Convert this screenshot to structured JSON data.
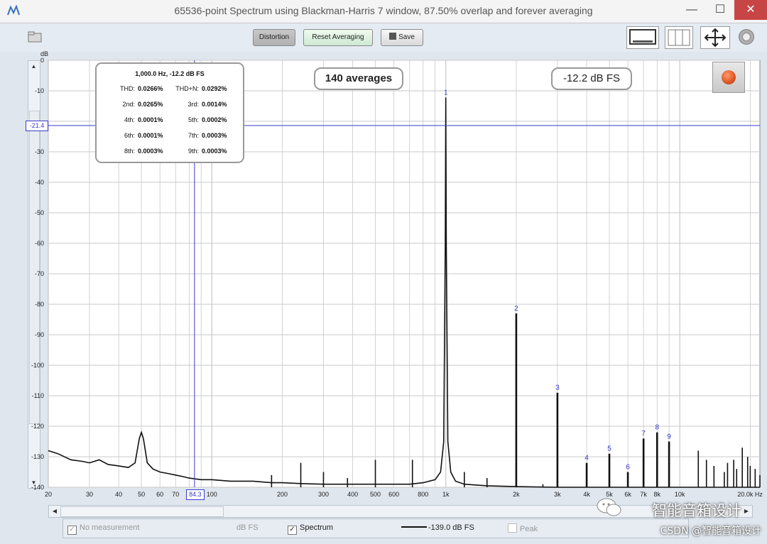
{
  "window": {
    "title": "65536-point Spectrum using Blackman-Harris 7 window, 87.50% overlap and forever averaging",
    "minimize": "—",
    "maximize": "☐",
    "close": "✕"
  },
  "toolbar": {
    "distortion_label": "Distortion",
    "reset_label": "Reset Averaging",
    "save_label": "Save"
  },
  "overlay": {
    "averages": "140 averages",
    "level": "-12.2 dB FS",
    "cursor_y": "-21.4",
    "cursor_x": "84.3"
  },
  "distortion_box": {
    "header": "1,000.0 Hz, -12.2 dB FS",
    "rows": [
      [
        {
          "k": "THD:",
          "v": "0.0266%"
        },
        {
          "k": "THD+N:",
          "v": "0.0292%"
        }
      ],
      [
        {
          "k": "2nd:",
          "v": "0.0265%"
        },
        {
          "k": "3rd:",
          "v": "0.0014%"
        }
      ],
      [
        {
          "k": "4th:",
          "v": "0.0001%"
        },
        {
          "k": "5th:",
          "v": "0.0002%"
        }
      ],
      [
        {
          "k": "6th:",
          "v": "0.0001%"
        },
        {
          "k": "7th:",
          "v": "0.0003%"
        }
      ],
      [
        {
          "k": "8th:",
          "v": "0.0003%"
        },
        {
          "k": "9th:",
          "v": "0.0003%"
        }
      ]
    ]
  },
  "colors": {
    "trace": "#111111",
    "grid": "#c8c8c8",
    "cursor": "#3a3acc",
    "marker_label": "#3a3acc",
    "record_button": "#e05a2a"
  },
  "bottom": {
    "no_measurement": "No measurement",
    "dbfs_label": "dB FS",
    "spectrum_label": "Spectrum",
    "spectrum_value": "-139.0 dB FS",
    "peak_label": "Peak"
  },
  "watermark": {
    "line1": "智能音箱设计",
    "line2": "CSDN @智能音箱设计"
  },
  "chart_data": {
    "type": "line",
    "title": "",
    "ylabel": "dB",
    "xlabel": "",
    "x_scale": "log",
    "xlim": [
      20,
      22000
    ],
    "ylim": [
      -140,
      0
    ],
    "grid": true,
    "y_ticks": [
      0,
      -10,
      -20,
      -30,
      -40,
      -50,
      -60,
      -70,
      -80,
      -90,
      -100,
      -110,
      -120,
      -130,
      -140
    ],
    "y_tick_labels": [
      "0",
      "-10",
      "",
      "-30",
      "-40",
      "-50",
      "-60",
      "-70",
      "-80",
      "-90",
      "-100",
      "-110",
      "-120",
      "-130",
      "-140"
    ],
    "x_ticks": [
      {
        "v": 20,
        "label": "20"
      },
      {
        "v": 30,
        "label": "30"
      },
      {
        "v": 40,
        "label": "40"
      },
      {
        "v": 50,
        "label": "50"
      },
      {
        "v": 60,
        "label": "60"
      },
      {
        "v": 70,
        "label": "70"
      },
      {
        "v": 100,
        "label": "100"
      },
      {
        "v": 200,
        "label": "200"
      },
      {
        "v": 300,
        "label": "300"
      },
      {
        "v": 400,
        "label": "400"
      },
      {
        "v": 500,
        "label": "500"
      },
      {
        "v": 600,
        "label": "600"
      },
      {
        "v": 800,
        "label": "800"
      },
      {
        "v": 1000,
        "label": "1k"
      },
      {
        "v": 2000,
        "label": "2k"
      },
      {
        "v": 3000,
        "label": "3k"
      },
      {
        "v": 4000,
        "label": "4k"
      },
      {
        "v": 5000,
        "label": "5k"
      },
      {
        "v": 6000,
        "label": "6k"
      },
      {
        "v": 7000,
        "label": "7k"
      },
      {
        "v": 8000,
        "label": "8k"
      },
      {
        "v": 10000,
        "label": "10k"
      },
      {
        "v": 20000,
        "label": "20.0k Hz"
      }
    ],
    "cursor": {
      "x": 84.3,
      "y": -21.4
    },
    "series": [
      {
        "values": [
          [
            20,
            -128
          ],
          [
            22,
            -129
          ],
          [
            25,
            -131
          ],
          [
            28,
            -131.5
          ],
          [
            30,
            -132
          ],
          [
            33,
            -131
          ],
          [
            36,
            -132.5
          ],
          [
            40,
            -133
          ],
          [
            44,
            -133.5
          ],
          [
            47,
            -132
          ],
          [
            49,
            -124
          ],
          [
            50,
            -122
          ],
          [
            51,
            -124
          ],
          [
            53,
            -132
          ],
          [
            56,
            -134
          ],
          [
            60,
            -135
          ],
          [
            65,
            -135.5
          ],
          [
            70,
            -136
          ],
          [
            75,
            -136.5
          ],
          [
            80,
            -137
          ],
          [
            90,
            -137.5
          ],
          [
            100,
            -137.5
          ],
          [
            120,
            -138
          ],
          [
            150,
            -138
          ],
          [
            180,
            -138.5
          ],
          [
            200,
            -138.5
          ],
          [
            240,
            -138.8
          ],
          [
            300,
            -139
          ],
          [
            400,
            -139
          ],
          [
            500,
            -139
          ],
          [
            600,
            -139
          ],
          [
            700,
            -139
          ],
          [
            800,
            -138.5
          ],
          [
            900,
            -137.5
          ],
          [
            950,
            -135
          ],
          [
            980,
            -125
          ],
          [
            995,
            -60
          ],
          [
            1000,
            -12.2
          ],
          [
            1005,
            -60
          ],
          [
            1020,
            -125
          ],
          [
            1050,
            -135
          ],
          [
            1100,
            -138
          ],
          [
            1200,
            -139
          ],
          [
            1500,
            -139.5
          ],
          [
            2000,
            -139.8
          ],
          [
            3000,
            -140
          ],
          [
            5000,
            -140
          ],
          [
            10000,
            -140
          ],
          [
            22000,
            -140
          ]
        ]
      }
    ],
    "spurs": [
      [
        180,
        -136
      ],
      [
        240,
        -132
      ],
      [
        300,
        -135
      ],
      [
        380,
        -137
      ],
      [
        500,
        -131
      ],
      [
        720,
        -131
      ],
      [
        1200,
        -135
      ],
      [
        1500,
        -137
      ],
      [
        2600,
        -139
      ],
      [
        14000,
        -133
      ],
      [
        15500,
        -135
      ],
      [
        17000,
        -131
      ],
      [
        17500,
        -134
      ],
      [
        18500,
        -127
      ],
      [
        19500,
        -130
      ],
      [
        21000,
        -134
      ],
      [
        22000,
        -136
      ],
      [
        12000,
        -128
      ],
      [
        13000,
        -131
      ],
      [
        16000,
        -132
      ],
      [
        20000,
        -133
      ]
    ],
    "harmonics": [
      {
        "label": "1",
        "x": 1000,
        "y": -12.2
      },
      {
        "label": "2",
        "x": 2000,
        "y": -83
      },
      {
        "label": "3",
        "x": 3000,
        "y": -109
      },
      {
        "label": "4",
        "x": 4000,
        "y": -132
      },
      {
        "label": "5",
        "x": 5000,
        "y": -129
      },
      {
        "label": "6",
        "x": 6000,
        "y": -135
      },
      {
        "label": "7",
        "x": 7000,
        "y": -124
      },
      {
        "label": "8",
        "x": 8000,
        "y": -122
      },
      {
        "label": "9",
        "x": 9000,
        "y": -125
      }
    ]
  }
}
